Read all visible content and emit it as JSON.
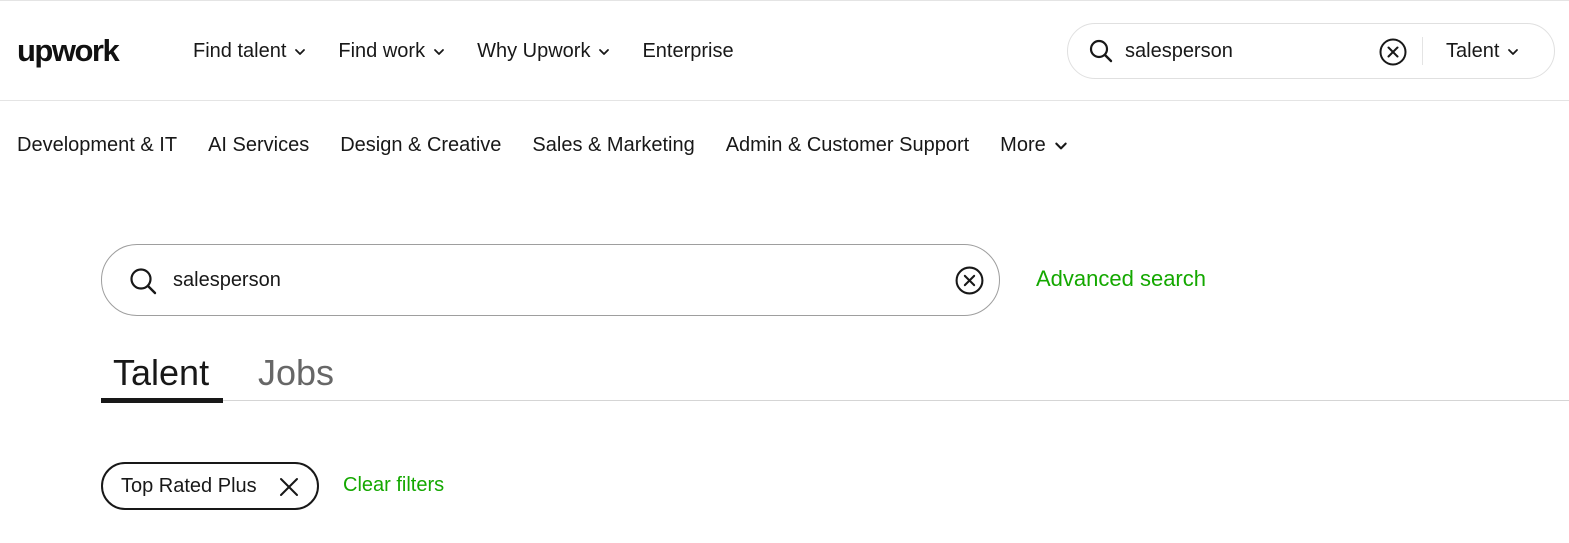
{
  "header": {
    "logo_text": "upwork",
    "nav": [
      {
        "label": "Find talent",
        "has_dropdown": true
      },
      {
        "label": "Find work",
        "has_dropdown": true
      },
      {
        "label": "Why Upwork",
        "has_dropdown": true
      },
      {
        "label": "Enterprise",
        "has_dropdown": false
      }
    ],
    "search": {
      "value": "salesperson",
      "type_selector": "Talent",
      "icon": "search-icon",
      "clear_icon": "clear-circle-icon"
    }
  },
  "categories": [
    {
      "label": "Development & IT"
    },
    {
      "label": "AI Services"
    },
    {
      "label": "Design & Creative"
    },
    {
      "label": "Sales & Marketing"
    },
    {
      "label": "Admin & Customer Support"
    },
    {
      "label": "More",
      "has_dropdown": true
    }
  ],
  "main_search": {
    "value": "salesperson",
    "advanced_link": "Advanced search"
  },
  "tabs": [
    {
      "label": "Talent",
      "active": true
    },
    {
      "label": "Jobs",
      "active": false
    }
  ],
  "filters": {
    "chips": [
      {
        "label": "Top Rated Plus",
        "remove_icon": "close-icon"
      }
    ],
    "clear_label": "Clear filters"
  },
  "colors": {
    "brand_green": "#14a800",
    "text": "#181818",
    "inactive_tab": "#676767",
    "border": "#e4e4e4"
  }
}
